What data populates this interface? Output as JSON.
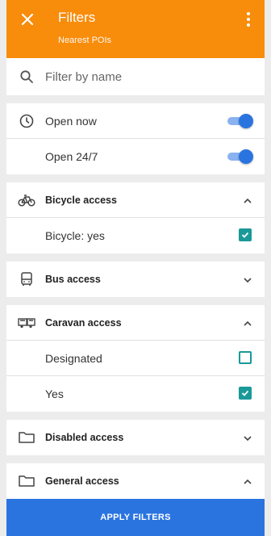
{
  "header": {
    "title": "Filters",
    "subtitle": "Nearest POIs",
    "close_icon": "close-icon",
    "menu_icon": "more-vert-icon",
    "color": "#f88c0b"
  },
  "search": {
    "placeholder": "Filter by name",
    "value": "",
    "icon": "search-icon"
  },
  "opening": {
    "icon": "clock-icon",
    "items": [
      {
        "label": "Open now",
        "enabled": true
      },
      {
        "label": "Open 24/7",
        "enabled": true
      }
    ]
  },
  "sections": [
    {
      "title": "Bicycle access",
      "icon": "bicycle-icon",
      "expanded": true,
      "options": [
        {
          "label": "Bicycle: yes",
          "checked": true
        }
      ]
    },
    {
      "title": "Bus access",
      "icon": "bus-icon",
      "expanded": false,
      "options": []
    },
    {
      "title": "Caravan access",
      "icon": "caravan-icon",
      "expanded": true,
      "options": [
        {
          "label": "Designated",
          "checked": false
        },
        {
          "label": "Yes",
          "checked": true
        }
      ]
    },
    {
      "title": "Disabled access",
      "icon": "folder-icon",
      "expanded": false,
      "options": []
    },
    {
      "title": "General access",
      "icon": "folder-icon",
      "expanded": true,
      "options": []
    }
  ],
  "apply_label": "APPLY FILTERS",
  "colors": {
    "accent": "#2a74e0",
    "checkbox": "#1a9999",
    "toggle_track": "#8ab2f0"
  }
}
